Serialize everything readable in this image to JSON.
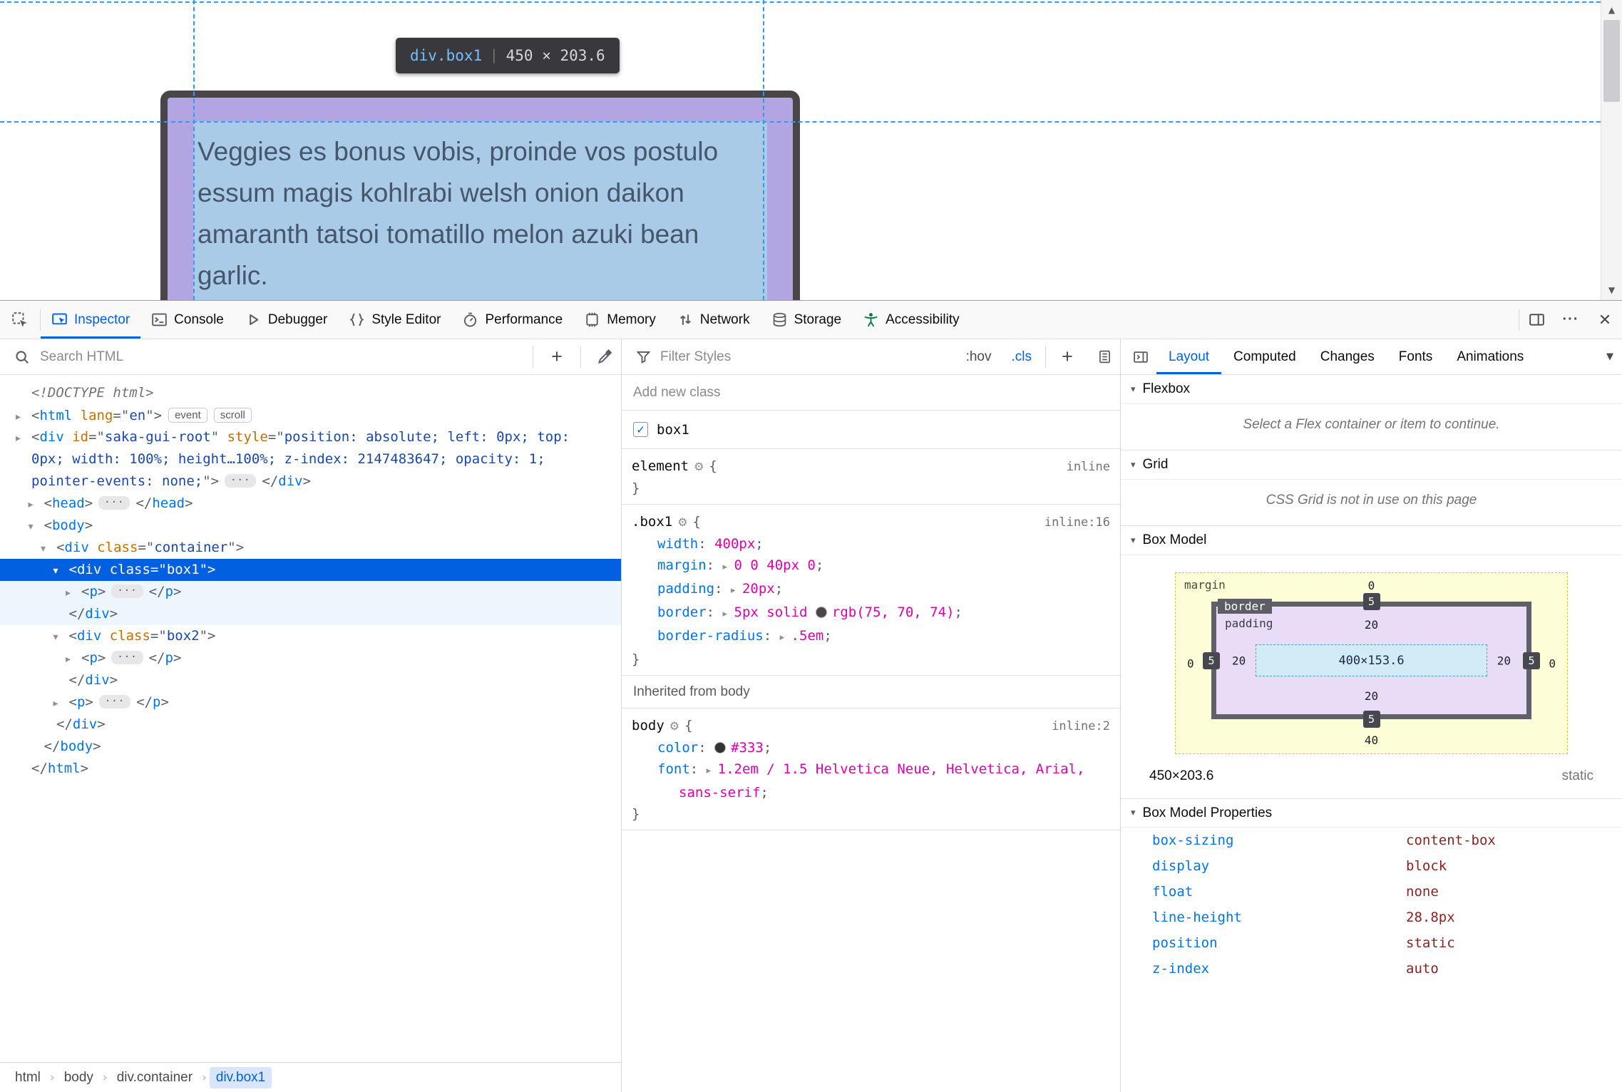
{
  "glyphs": {
    "check": "✓",
    "plus": "+",
    "meatball": "···",
    "close": "✕",
    "scroll_up": "▲",
    "scroll_down": "▼",
    "tabs_overflow": "▼",
    "twisty_open": "▾",
    "crumb_sep": "›"
  },
  "page": {
    "infobar": {
      "selector": "div.box1",
      "separator": "|",
      "dims": "450 × 203.6"
    },
    "paragraph_lines": [
      "Veggies es bonus vobis, proinde vos postulo",
      "essum magis kohlrabi welsh onion daikon",
      "amaranth tatsoi tomatillo melon azuki bean",
      "garlic."
    ]
  },
  "devtools": {
    "tabs": [
      {
        "icon": "inspector",
        "label": "Inspector",
        "active": true
      },
      {
        "icon": "console",
        "label": "Console"
      },
      {
        "icon": "debugger",
        "label": "Debugger"
      },
      {
        "icon": "style-editor",
        "label": "Style Editor"
      },
      {
        "icon": "performance",
        "label": "Performance"
      },
      {
        "icon": "memory",
        "label": "Memory"
      },
      {
        "icon": "network",
        "label": "Network"
      },
      {
        "icon": "storage",
        "label": "Storage"
      },
      {
        "icon": "accessibility",
        "label": "Accessibility"
      }
    ],
    "markup": {
      "search_placeholder": "Search HTML",
      "lines": [
        {
          "ind": 0,
          "tok": [
            {
              "c": "doctype",
              "t": "<!DOCTYPE html>"
            }
          ]
        },
        {
          "ind": 0,
          "tw": "▸",
          "tok": [
            {
              "c": "punc",
              "t": "<"
            },
            {
              "c": "tag",
              "t": "html"
            },
            {
              "c": "attr",
              "t": " lang"
            },
            {
              "c": "punc",
              "t": "=\""
            },
            {
              "c": "val",
              "t": "en"
            },
            {
              "c": "punc",
              "t": "\">"
            },
            {
              "c": "badge",
              "t": "event"
            },
            {
              "c": "badge",
              "t": "scroll"
            }
          ]
        },
        {
          "ind": 0,
          "tw": "▸",
          "tok": [
            {
              "c": "punc",
              "t": "<"
            },
            {
              "c": "tag",
              "t": "div"
            },
            {
              "c": "attr",
              "t": " id"
            },
            {
              "c": "punc",
              "t": "=\""
            },
            {
              "c": "val",
              "t": "saka-gui-root"
            },
            {
              "c": "punc",
              "t": "\" "
            },
            {
              "c": "attr",
              "t": "style"
            },
            {
              "c": "punc",
              "t": "=\""
            },
            {
              "c": "val",
              "t": "position: absolute; left: 0px; top:"
            }
          ]
        },
        {
          "ind": 0,
          "tok": [
            {
              "c": "val",
              "t": "0px; width: 100%; height…100%; z-index: 2147483647; opacity: 1;"
            }
          ]
        },
        {
          "ind": 0,
          "tok": [
            {
              "c": "val",
              "t": "pointer-events: none;"
            },
            {
              "c": "punc",
              "t": "\">"
            },
            {
              "c": "ellipsis",
              "t": "···"
            },
            {
              "c": "punc",
              "t": "</"
            },
            {
              "c": "tag",
              "t": "div"
            },
            {
              "c": "punc",
              "t": ">"
            }
          ]
        },
        {
          "ind": 1,
          "tw": "▸",
          "tok": [
            {
              "c": "punc",
              "t": "<"
            },
            {
              "c": "tag",
              "t": "head"
            },
            {
              "c": "punc",
              "t": ">"
            },
            {
              "c": "ellipsis",
              "t": "···"
            },
            {
              "c": "punc",
              "t": "</"
            },
            {
              "c": "tag",
              "t": "head"
            },
            {
              "c": "punc",
              "t": ">"
            }
          ]
        },
        {
          "ind": 1,
          "tw": "▾",
          "tok": [
            {
              "c": "punc",
              "t": "<"
            },
            {
              "c": "tag",
              "t": "body"
            },
            {
              "c": "punc",
              "t": ">"
            }
          ]
        },
        {
          "ind": 2,
          "tw": "▾",
          "tok": [
            {
              "c": "punc",
              "t": "<"
            },
            {
              "c": "tag",
              "t": "div"
            },
            {
              "c": "attr",
              "t": " class"
            },
            {
              "c": "punc",
              "t": "=\""
            },
            {
              "c": "val",
              "t": "container"
            },
            {
              "c": "punc",
              "t": "\">"
            }
          ]
        },
        {
          "ind": 3,
          "tw": "▾",
          "cls": "selected",
          "tok": [
            {
              "c": "punc",
              "t": "<"
            },
            {
              "c": "tag",
              "t": "div"
            },
            {
              "c": "attr",
              "t": " class"
            },
            {
              "c": "punc",
              "t": "=\""
            },
            {
              "c": "val",
              "t": "box1"
            },
            {
              "c": "punc",
              "t": "\">"
            }
          ]
        },
        {
          "ind": 4,
          "tw": "▸",
          "cls": "childbg",
          "tok": [
            {
              "c": "punc",
              "t": "<"
            },
            {
              "c": "tag",
              "t": "p"
            },
            {
              "c": "punc",
              "t": ">"
            },
            {
              "c": "ellipsis",
              "t": "···"
            },
            {
              "c": "punc",
              "t": "</"
            },
            {
              "c": "tag",
              "t": "p"
            },
            {
              "c": "punc",
              "t": ">"
            }
          ]
        },
        {
          "ind": 3,
          "cls": "childbg",
          "tok": [
            {
              "c": "punc",
              "t": "</"
            },
            {
              "c": "tag",
              "t": "div"
            },
            {
              "c": "punc",
              "t": ">"
            }
          ]
        },
        {
          "ind": 3,
          "tw": "▾",
          "tok": [
            {
              "c": "punc",
              "t": "<"
            },
            {
              "c": "tag",
              "t": "div"
            },
            {
              "c": "attr",
              "t": " class"
            },
            {
              "c": "punc",
              "t": "=\""
            },
            {
              "c": "val",
              "t": "box2"
            },
            {
              "c": "punc",
              "t": "\">"
            }
          ]
        },
        {
          "ind": 4,
          "tw": "▸",
          "tok": [
            {
              "c": "punc",
              "t": "<"
            },
            {
              "c": "tag",
              "t": "p"
            },
            {
              "c": "punc",
              "t": ">"
            },
            {
              "c": "ellipsis",
              "t": "···"
            },
            {
              "c": "punc",
              "t": "</"
            },
            {
              "c": "tag",
              "t": "p"
            },
            {
              "c": "punc",
              "t": ">"
            }
          ]
        },
        {
          "ind": 3,
          "tok": [
            {
              "c": "punc",
              "t": "</"
            },
            {
              "c": "tag",
              "t": "div"
            },
            {
              "c": "punc",
              "t": ">"
            }
          ]
        },
        {
          "ind": 3,
          "tw": "▸",
          "tok": [
            {
              "c": "punc",
              "t": "<"
            },
            {
              "c": "tag",
              "t": "p"
            },
            {
              "c": "punc",
              "t": ">"
            },
            {
              "c": "ellipsis",
              "t": "···"
            },
            {
              "c": "punc",
              "t": "</"
            },
            {
              "c": "tag",
              "t": "p"
            },
            {
              "c": "punc",
              "t": ">"
            }
          ]
        },
        {
          "ind": 2,
          "tok": [
            {
              "c": "punc",
              "t": "</"
            },
            {
              "c": "tag",
              "t": "div"
            },
            {
              "c": "punc",
              "t": ">"
            }
          ]
        },
        {
          "ind": 1,
          "tok": [
            {
              "c": "punc",
              "t": "</"
            },
            {
              "c": "tag",
              "t": "body"
            },
            {
              "c": "punc",
              "t": ">"
            }
          ]
        },
        {
          "ind": 0,
          "tok": [
            {
              "c": "punc",
              "t": "</"
            },
            {
              "c": "tag",
              "t": "html"
            },
            {
              "c": "punc",
              "t": ">"
            }
          ]
        }
      ],
      "breadcrumbs": [
        {
          "label": "html"
        },
        {
          "label": "body"
        },
        {
          "label": "div.container"
        },
        {
          "label": "div.box1",
          "selected": true
        }
      ]
    },
    "rules": {
      "filter_placeholder": "Filter Styles",
      "pseudo_button": ":hov",
      "class_button": ".cls",
      "add_class_placeholder": "Add new class",
      "class_toggle": {
        "checked": true,
        "label": "box1"
      },
      "sections": [
        {
          "type": "rule",
          "sel": "element",
          "loc": "inline",
          "props": []
        },
        {
          "type": "rule",
          "sel": ".box1",
          "loc": "inline:16",
          "props": [
            {
              "name": "width",
              "tokens": [
                {
                  "c": "value",
                  "t": "400px"
                }
              ]
            },
            {
              "name": "margin",
              "tw": true,
              "tokens": [
                {
                  "c": "value",
                  "t": "0 0 40px 0"
                }
              ]
            },
            {
              "name": "padding",
              "tw": true,
              "tokens": [
                {
                  "c": "value",
                  "t": "20px"
                }
              ]
            },
            {
              "name": "border",
              "tw": true,
              "tokens": [
                {
                  "c": "value",
                  "t": "5px solid "
                },
                {
                  "c": "swatch",
                  "t": "#4B464A"
                },
                {
                  "c": "value",
                  "t": "rgb(75, 70, 74)"
                }
              ]
            },
            {
              "name": "border-radius",
              "tw": true,
              "tokens": [
                {
                  "c": "value",
                  "t": ".5em"
                }
              ]
            }
          ]
        },
        {
          "type": "header",
          "text": "Inherited from body"
        },
        {
          "type": "rule",
          "sel": "body",
          "loc": "inline:2",
          "props": [
            {
              "name": "color",
              "tokens": [
                {
                  "c": "swatch",
                  "t": "#333333"
                },
                {
                  "c": "value",
                  "t": "#333"
                }
              ]
            },
            {
              "name": "font",
              "tw": true,
              "tokens": [
                {
                  "c": "value",
                  "t": "1.2em / 1.5 Helvetica Neue, Helvetica, Arial,"
                }
              ],
              "cont": [
                {
                  "c": "value",
                  "t": "sans-serif"
                },
                {
                  "c": "punc",
                  "t": ";"
                }
              ]
            }
          ]
        }
      ]
    },
    "layout": {
      "tabs": [
        {
          "label": "Layout",
          "active": true
        },
        {
          "label": "Computed"
        },
        {
          "label": "Changes"
        },
        {
          "label": "Fonts"
        },
        {
          "label": "Animations"
        }
      ],
      "flexbox": {
        "title": "Flexbox",
        "message": "Select a Flex container or item to continue."
      },
      "grid": {
        "title": "Grid",
        "message": "CSS Grid is not in use on this page"
      },
      "box_model": {
        "title": "Box Model",
        "labels": {
          "margin": "margin",
          "border": "border",
          "padding": "padding"
        },
        "margin": {
          "top": "0",
          "right": "0",
          "bottom": "40",
          "left": "0"
        },
        "border": {
          "top": "5",
          "right": "5",
          "bottom": "5",
          "left": "5"
        },
        "padding": {
          "top": "20",
          "right": "20",
          "bottom": "20",
          "left": "20"
        },
        "content": "400×153.6",
        "summary_dims": "450×203.6",
        "summary_position": "static"
      },
      "properties": {
        "title": "Box Model Properties",
        "rows": [
          [
            "box-sizing",
            "content-box"
          ],
          [
            "display",
            "block"
          ],
          [
            "float",
            "none"
          ],
          [
            "line-height",
            "28.8px"
          ],
          [
            "position",
            "static"
          ],
          [
            "z-index",
            "auto"
          ]
        ]
      }
    }
  }
}
